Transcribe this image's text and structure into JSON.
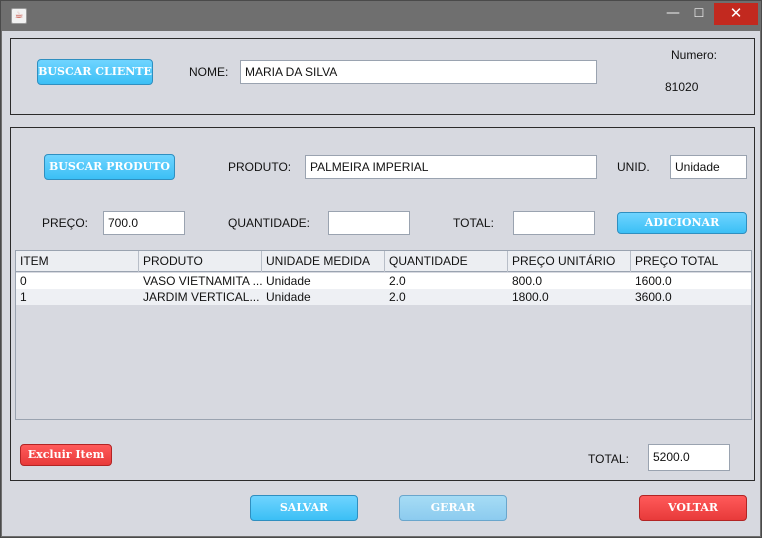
{
  "window": {
    "java_icon": "java-coffee-icon",
    "minimize_glyph": "—",
    "maximize_glyph": "☐",
    "close_glyph": "✕"
  },
  "client": {
    "search_button": "BUSCAR CLIENTE",
    "name_label": "NOME:",
    "name_value": "MARIA DA SILVA",
    "number_label": "Numero:",
    "number_value": "81020"
  },
  "product": {
    "search_button": "BUSCAR PRODUTO",
    "product_label": "PRODUTO:",
    "product_value": "PALMEIRA IMPERIAL",
    "unit_label": "UNID.",
    "unit_value": "Unidade",
    "price_label": "PREÇO:",
    "price_value": "700.0",
    "quantity_label": "QUANTIDADE:",
    "quantity_value": "",
    "total_label": "TOTAL:",
    "total_value": "",
    "add_button": "ADICIONAR"
  },
  "table": {
    "columns": [
      "ITEM",
      "PRODUTO",
      "UNIDADE MEDIDA",
      "QUANTIDADE",
      "PREÇO UNITÁRIO",
      "PREÇO TOTAL"
    ],
    "rows": [
      [
        "0",
        "VASO VIETNAMITA ...",
        "Unidade",
        "2.0",
        "800.0",
        "1600.0"
      ],
      [
        "1",
        "JARDIM VERTICAL...",
        "Unidade",
        "2.0",
        "1800.0",
        "3600.0"
      ]
    ]
  },
  "footer": {
    "delete_item_button": "Excluir Item",
    "total_label": "TOTAL:",
    "total_value": "5200.0",
    "save_button": "SALVAR",
    "generate_button": "GERAR",
    "back_button": "VOLTAR"
  },
  "colors": {
    "background": "#d7d9e0",
    "button_blue": "#3bbff5",
    "button_red": "#e83a3a",
    "close_red": "#c2291f"
  }
}
